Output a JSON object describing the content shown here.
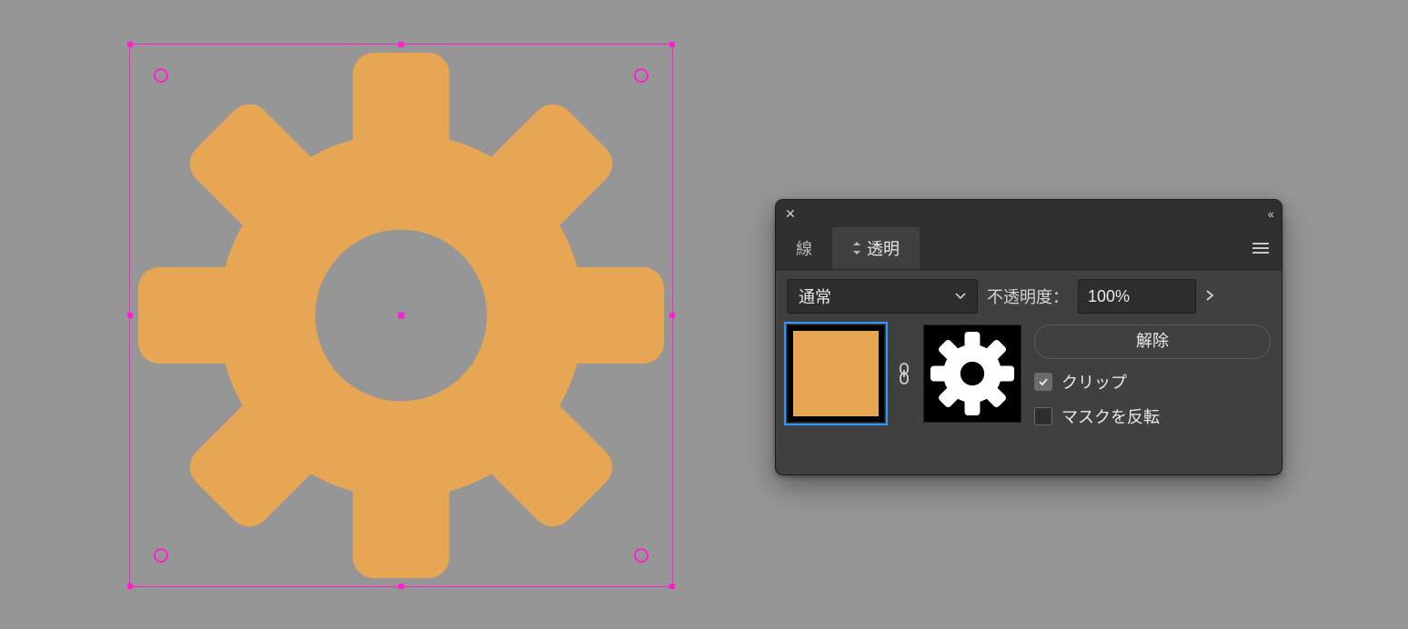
{
  "canvas": {
    "selection_color": "#ff1fd0",
    "artwork_fill": "#e7a654"
  },
  "panel": {
    "tabs": {
      "stroke": "線",
      "transparency": "透明"
    },
    "blend_mode": "通常",
    "opacity_label": "不透明度：",
    "opacity_value": "100%",
    "release_button": "解除",
    "clip_label": "クリップ",
    "invert_label": "マスクを反転",
    "clip_checked": true,
    "invert_checked": false
  }
}
